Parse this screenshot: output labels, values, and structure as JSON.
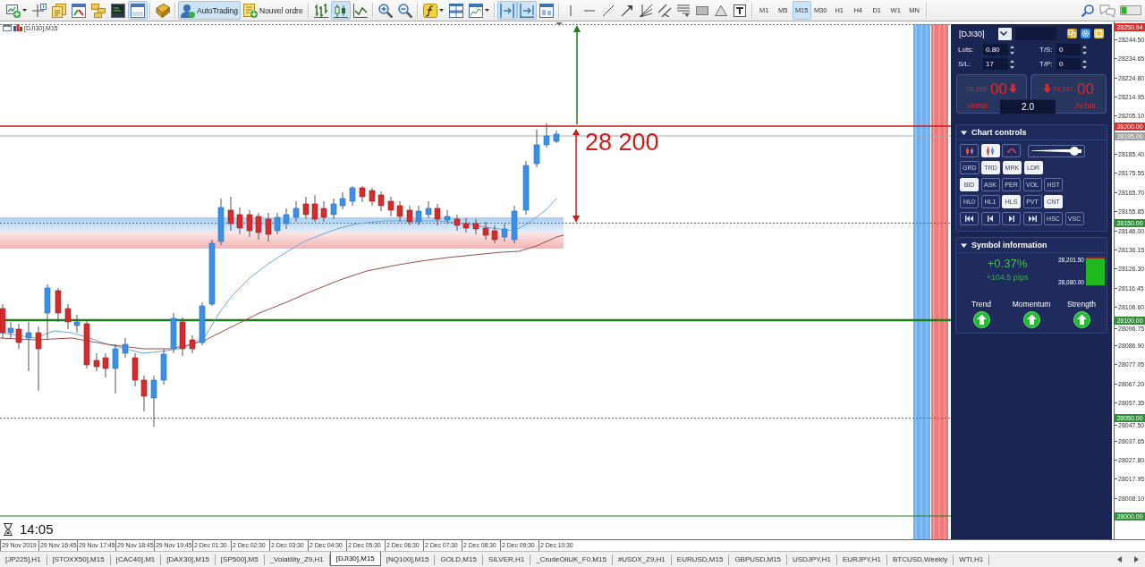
{
  "toolbar": {
    "standard": [
      {
        "pressed": false
      },
      {
        "pressed": false
      },
      {
        "pressed": false
      },
      {
        "pressed": false
      },
      {
        "pressed": false
      },
      {
        "pressed": false
      },
      {
        "pressed": true
      }
    ],
    "autotrading": {
      "label": "AutoTrading",
      "pressed": true
    },
    "new_order": {
      "label": "Nouvel ordre",
      "pressed": false
    },
    "chart_types": [
      {
        "selected": false
      },
      {
        "selected": true
      },
      {
        "selected": false
      }
    ],
    "chart_view": [
      {
        "pressed": true
      },
      {
        "pressed": true
      },
      {
        "pressed": false
      }
    ],
    "timeframes": [
      {
        "label": "M1",
        "selected": false
      },
      {
        "label": "M5",
        "selected": false
      },
      {
        "label": "M15",
        "selected": true
      },
      {
        "label": "M30",
        "selected": false
      },
      {
        "label": "H1",
        "selected": false
      },
      {
        "label": "H4",
        "selected": false
      },
      {
        "label": "D1",
        "selected": false
      },
      {
        "label": "W1",
        "selected": false
      },
      {
        "label": "MN",
        "selected": false
      }
    ]
  },
  "chart": {
    "label": "[DJI30],M15",
    "target_label": "28 200",
    "clock": "14:05",
    "price_ticks": [
      "28244.50",
      "28234.65",
      "28224.80",
      "28214.95",
      "28205.10",
      "28185.40",
      "28175.55",
      "28165.70",
      "28155.85",
      "28146.00",
      "28136.15",
      "28126.30",
      "28116.45",
      "28106.60",
      "28096.75",
      "28086.90",
      "28077.05",
      "28067.20",
      "28057.35",
      "28047.50",
      "28037.65",
      "28027.80",
      "28017.95",
      "28008.10"
    ],
    "price_markers": [
      {
        "label": "28250.94",
        "color": "#d62f2f"
      },
      {
        "label": "28200.00",
        "color": "#d62f2f"
      },
      {
        "label": "28195.00",
        "color": "#a0a0a0"
      },
      {
        "label": "28150.00",
        "color": "#2f8f36"
      },
      {
        "label": "28100.00",
        "color": "#2f8f36"
      },
      {
        "label": "28050.00",
        "color": "#2f8f36"
      },
      {
        "label": "28000.00",
        "color": "#2f8f36"
      }
    ],
    "time_labels": [
      "29 Nov 2019",
      "29 Nov 16:45",
      "29 Nov 17:45",
      "29 Nov 18:45",
      "29 Nov 19:45",
      "2 Dec 01:30",
      "2 Dec 02:30",
      "2 Dec 03:30",
      "2 Dec 04:30",
      "2 Dec 05:30",
      "2 Dec 06:30",
      "2 Dec 07:30",
      "2 Dec 08:30",
      "2 Dec 09:30",
      "2 Dec 10:30"
    ]
  },
  "trade_panel": {
    "symbol": "[DJI30]",
    "fields": [
      {
        "label": "Lots:",
        "value": "0.80"
      },
      {
        "label": "T/S:",
        "value": "0"
      },
      {
        "label": "S/L:",
        "value": "17"
      },
      {
        "label": "T/P:",
        "value": "0"
      }
    ],
    "sell": {
      "price_main": "28,195.",
      "price_pips": "00",
      "label": "Vente"
    },
    "buy": {
      "price_main": "28,197.",
      "price_pips": "00",
      "label": "Achat"
    },
    "spread": "2.0",
    "chart_controls": {
      "title": "Chart controls",
      "expanded": true,
      "icon_buttons": [
        {
          "selected": false
        },
        {
          "selected": true
        },
        {
          "selected": false
        }
      ],
      "zoom_slider": {
        "level": 0.8
      },
      "rows": [
        {
          "buttons": [
            {
              "kind": "text",
              "label": "GRD",
              "selected": false
            },
            {
              "kind": "text",
              "label": "TRD",
              "selected": true
            },
            {
              "kind": "text",
              "label": "MRK",
              "selected": true
            },
            {
              "kind": "text",
              "label": "LDR",
              "selected": true
            }
          ]
        },
        {
          "buttons": [
            {
              "kind": "text",
              "label": "BID",
              "selected": true
            },
            {
              "kind": "text",
              "label": "ASK",
              "selected": false
            },
            {
              "kind": "text",
              "label": "PER",
              "selected": false
            },
            {
              "kind": "text",
              "label": "VOL",
              "selected": false
            },
            {
              "kind": "text",
              "label": "HST",
              "selected": false
            }
          ]
        },
        {
          "buttons": [
            {
              "kind": "text",
              "label": "HL0",
              "selected": false
            },
            {
              "kind": "text",
              "label": "HL1",
              "selected": false
            },
            {
              "kind": "text",
              "label": "HLS",
              "selected": true
            },
            {
              "kind": "text",
              "label": "PVT",
              "selected": false
            },
            {
              "kind": "text",
              "label": "CNT",
              "selected": true
            }
          ]
        },
        {
          "buttons": [
            {
              "kind": "icon",
              "selected": false
            },
            {
              "kind": "icon",
              "selected": false
            },
            {
              "kind": "icon",
              "selected": false
            },
            {
              "kind": "icon",
              "selected": false
            },
            {
              "kind": "text",
              "label": "HSC",
              "selected": false
            },
            {
              "kind": "text",
              "label": "VSC",
              "selected": false
            }
          ]
        }
      ]
    },
    "symbol_info": {
      "title": "Symbol information",
      "expanded": true,
      "change": "+0.37%",
      "pips": "+104.5 pips",
      "high": "28,201.50",
      "low": "28,080.00",
      "range": {
        "level": 0.94
      },
      "signals": [
        {
          "label": "Trend",
          "rising": true
        },
        {
          "label": "Momentum",
          "rising": true
        },
        {
          "label": "Strength",
          "rising": true
        }
      ]
    }
  },
  "tabs": [
    {
      "label": "[JP225],H1",
      "selected": false
    },
    {
      "label": "[STOXX50],M15",
      "selected": false
    },
    {
      "label": "[CAC40],M1",
      "selected": false
    },
    {
      "label": "[DAX30],M15",
      "selected": false
    },
    {
      "label": "[SP500],M5",
      "selected": false
    },
    {
      "label": "_Volatility_Z9,H1",
      "selected": false
    },
    {
      "label": "[DJI30],M15",
      "selected": true
    },
    {
      "label": "[NQ100],M15",
      "selected": false
    },
    {
      "label": "GOLD,M15",
      "selected": false
    },
    {
      "label": "SILVER,H1",
      "selected": false
    },
    {
      "label": "_CrudeOilUK_F0,M15",
      "selected": false
    },
    {
      "label": "#USDX_Z9,H1",
      "selected": false
    },
    {
      "label": "EURUSD,M15",
      "selected": false
    },
    {
      "label": "GBPUSD,M15",
      "selected": false
    },
    {
      "label": "USDJPY,H1",
      "selected": false
    },
    {
      "label": "EURJPY,H1",
      "selected": false
    },
    {
      "label": "BTCUSD,Weekly",
      "selected": false
    },
    {
      "label": "WTI,H1",
      "selected": false
    }
  ]
}
